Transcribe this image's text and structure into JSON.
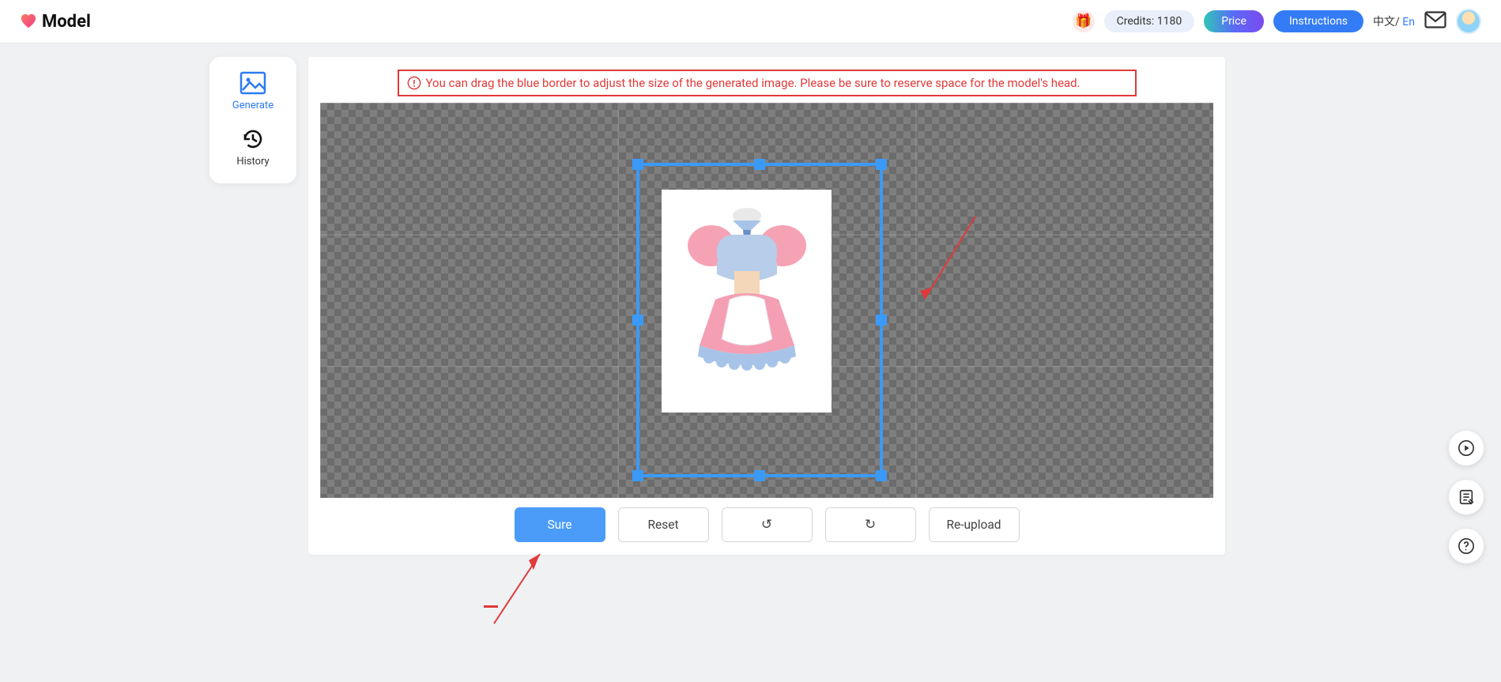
{
  "header": {
    "logo_text": "Model",
    "credits_label": "Credits: 1180",
    "price_label": "Price",
    "instructions_label": "Instructions",
    "lang_zh": "中文",
    "lang_sep": "/",
    "lang_en": "En"
  },
  "sidenav": {
    "generate_label": "Generate",
    "history_label": "History"
  },
  "notice": {
    "text": "You can drag the blue border to adjust the size of the generated image. Please be sure to reserve space for the model's head."
  },
  "actions": {
    "sure": "Sure",
    "reset": "Reset",
    "rotate_ccw": "↺",
    "rotate_cw": "↻",
    "reupload": "Re-upload"
  }
}
